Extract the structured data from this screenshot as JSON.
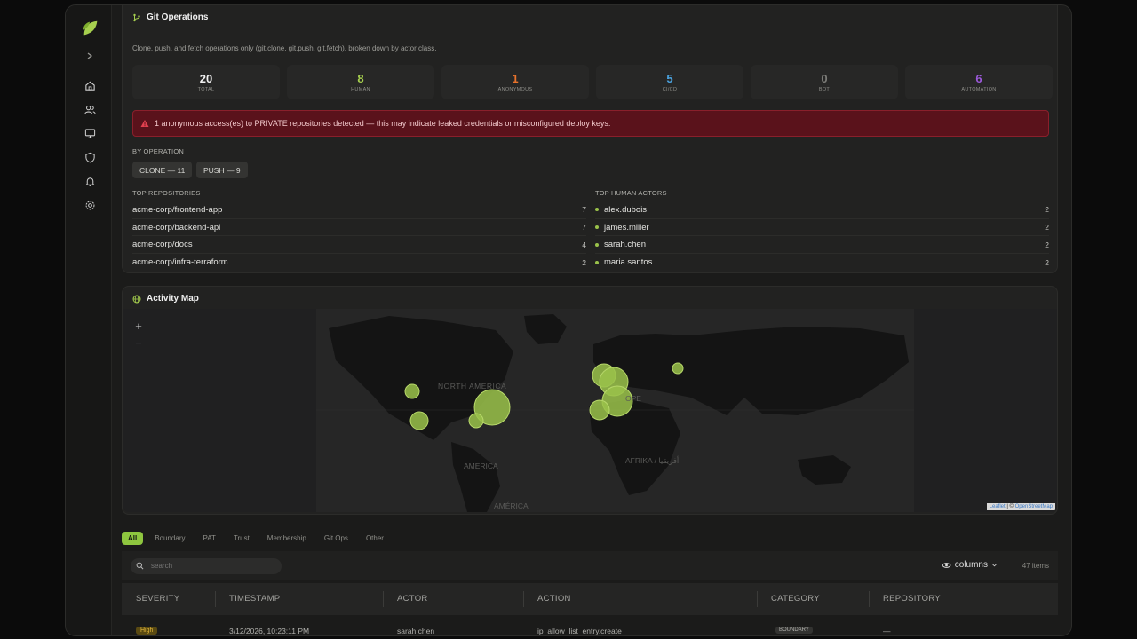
{
  "git_ops": {
    "title": "Git Operations",
    "subtitle": "Clone, push, and fetch operations only (git.clone, git.push, git.fetch), broken down by actor class.",
    "stats": [
      {
        "value": "20",
        "label": "TOTAL",
        "color": "#f2f2f2"
      },
      {
        "value": "8",
        "label": "HUMAN",
        "color": "#a6cf4e"
      },
      {
        "value": "1",
        "label": "ANONYMOUS",
        "color": "#e8732c"
      },
      {
        "value": "5",
        "label": "CI/CD",
        "color": "#4aa3e0"
      },
      {
        "value": "0",
        "label": "BOT",
        "color": "#7c7c78"
      },
      {
        "value": "6",
        "label": "AUTOMATION",
        "color": "#9b59d9"
      }
    ],
    "alert": "1 anonymous access(es) to PRIVATE repositories detected — this may indicate leaked credentials or misconfigured deploy keys.",
    "by_operation_label": "BY OPERATION",
    "operations": [
      "CLONE — 11",
      "PUSH — 9"
    ],
    "top_repos_label": "TOP REPOSITORIES",
    "top_repos": [
      {
        "name": "acme-corp/frontend-app",
        "count": "7"
      },
      {
        "name": "acme-corp/backend-api",
        "count": "7"
      },
      {
        "name": "acme-corp/docs",
        "count": "4"
      },
      {
        "name": "acme-corp/infra-terraform",
        "count": "2"
      }
    ],
    "top_actors_label": "TOP HUMAN ACTORS",
    "top_actors": [
      {
        "name": "alex.dubois",
        "count": "2"
      },
      {
        "name": "james.miller",
        "count": "2"
      },
      {
        "name": "sarah.chen",
        "count": "2"
      },
      {
        "name": "maria.santos",
        "count": "2"
      }
    ]
  },
  "activity_map": {
    "title": "Activity Map",
    "zoom_in": "+",
    "zoom_out": "−",
    "labels": {
      "north_america": "NORTH AMERICA",
      "europe": "OPE",
      "africa": "AFRIKA / أفريقيا",
      "south_america_1": "AMERICA",
      "south_america_2": "AMÉRICA"
    },
    "attribution_leaflet": "Leaflet",
    "attribution_sep": " | © ",
    "attribution_osm": "OpenStreetMap",
    "marker_color": "#9ac24a"
  },
  "filters": [
    "All",
    "Boundary",
    "PAT",
    "Trust",
    "Membership",
    "Git Ops",
    "Other"
  ],
  "toolbar": {
    "search_placeholder": "search",
    "columns_label": "columns",
    "item_count": "47 items"
  },
  "table": {
    "headers": [
      "SEVERITY",
      "TIMESTAMP",
      "ACTOR",
      "ACTION",
      "CATEGORY",
      "REPOSITORY"
    ],
    "first_row": {
      "severity": "High",
      "timestamp": "3/12/2026, 10:23:11 PM",
      "actor": "sarah.chen",
      "action": "ip_allow_list_entry.create",
      "category": "BOUNDARY",
      "repository": "—"
    }
  }
}
